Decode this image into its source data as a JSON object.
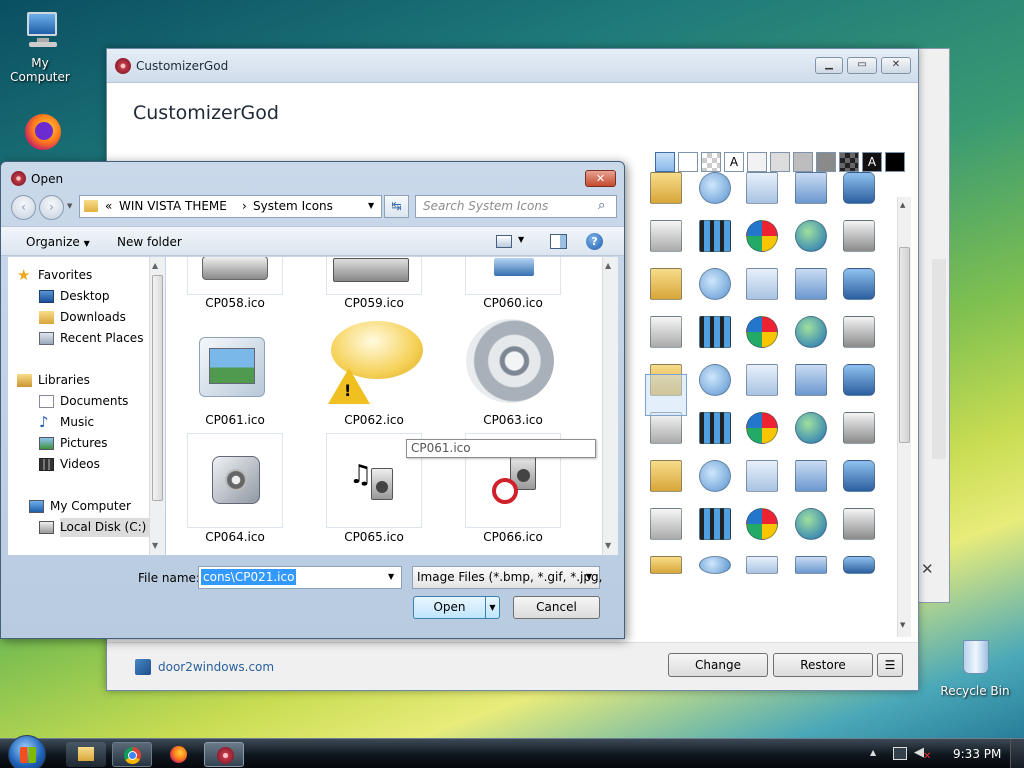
{
  "desktop": {
    "icons": [
      {
        "label": "My Computer"
      },
      {
        "label": ""
      },
      {
        "label": "Recycle Bin"
      }
    ]
  },
  "main_window": {
    "title": "CustomizerGod",
    "heading": "CustomizerGod",
    "footer_link": "door2windows.com",
    "change_label": "Change",
    "restore_label": "Restore",
    "menu_label": "☰"
  },
  "dialog": {
    "title": "Open",
    "path": {
      "root": "«",
      "folder1": "WIN VISTA THEME",
      "separator": "›",
      "folder2": "System Icons"
    },
    "search_placeholder": "Search System Icons",
    "organize_label": "Organize",
    "new_folder_label": "New folder",
    "nav": {
      "favorites": "Favorites",
      "desktop": "Desktop",
      "downloads": "Downloads",
      "recent_places": "Recent Places",
      "libraries": "Libraries",
      "documents": "Documents",
      "music": "Music",
      "pictures": "Pictures",
      "videos": "Videos",
      "my_computer": "My Computer",
      "local_disk": "Local Disk (C:)"
    },
    "files": [
      {
        "name": "CP058.ico"
      },
      {
        "name": "CP059.ico"
      },
      {
        "name": "CP060.ico"
      },
      {
        "name": "CP061.ico"
      },
      {
        "name": "CP062.ico"
      },
      {
        "name": "CP063.ico"
      },
      {
        "name": "CP064.ico"
      },
      {
        "name": "CP065.ico"
      },
      {
        "name": "CP066.ico"
      }
    ],
    "tooltip": "CP061.ico",
    "file_name_label": "File name:",
    "file_name_value": "cons\\CP021.ico",
    "file_type_value": "Image Files (*.bmp, *.gif, *.jpg,",
    "open_label": "Open",
    "cancel_label": "Cancel"
  },
  "taskbar": {
    "clock": "9:33 PM"
  },
  "colors": {
    "accent": "#3c7fb1",
    "title_bar": "#cfdcea",
    "selection": "#3399ff"
  }
}
